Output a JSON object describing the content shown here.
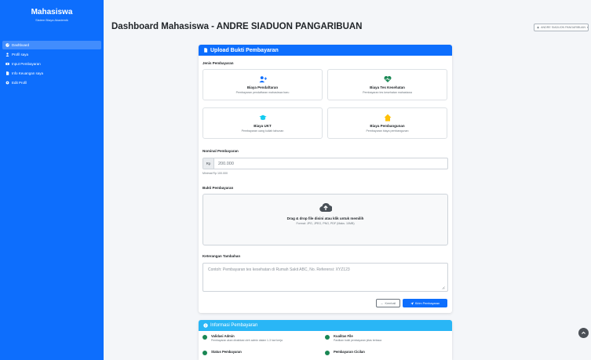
{
  "sidebar": {
    "brand_title": "Mahasiswa",
    "brand_subtitle": "Sistem Biaya Akademik",
    "items": [
      {
        "label": "Dashboard",
        "icon": "dashboard-icon",
        "active": true
      },
      {
        "label": "Profil saya",
        "icon": "user-icon",
        "active": false
      },
      {
        "label": "Input Pembayaran",
        "icon": "money-icon",
        "active": false
      },
      {
        "label": "Info Keuangan saya",
        "icon": "file-icon",
        "active": false
      },
      {
        "label": "Edit Profil",
        "icon": "gear-icon",
        "active": false
      }
    ]
  },
  "header": {
    "title": "Dashboard Mahasiswa - ANDRE SIADUON PANGARIBUAN",
    "user_button": "ANDRE SIADUON PANGARIBUAN"
  },
  "upload": {
    "card_title": "Upload Bukti Pembayaran",
    "jenis_label": "Jenis Pembayaran",
    "options": [
      {
        "title": "Biaya Pendaftaran",
        "desc": "Pembayaran pendaftaran mahasiswa baru",
        "icon": "user-plus-icon",
        "color": "#0d6efd"
      },
      {
        "title": "Biaya Tes Kesehatan",
        "desc": "Pembayaran tes kesehatan mahasiswa",
        "icon": "heartbeat-icon",
        "color": "#198754"
      },
      {
        "title": "Biaya UKT",
        "desc": "Pembayaran uang kuliah tahunan",
        "icon": "graduation-cap-icon",
        "color": "#0dcaf0"
      },
      {
        "title": "Biaya Pembangunan",
        "desc": "Pembayaran biaya pembangunan",
        "icon": "home-icon",
        "color": "#ffc107"
      }
    ],
    "nominal_label": "Nominal Pembayaran",
    "currency": "Rp",
    "nominal_value": "200.000",
    "nominal_hint": "Minimal Rp 100.000",
    "bukti_label": "Bukti Pembayaran",
    "dropzone_title": "Drag & drop file disini atau klik untuk memilih",
    "dropzone_sub": "Format: JPG, JPEG, PNG, PDF (Maks. 10MB)",
    "keterangan_label": "Keterangan Tambahan",
    "keterangan_placeholder": "Contoh: Pembayaran tes kesehatan di Rumah Sakit ABC, No. Referensi: XYZ123",
    "back_button": "Kembali",
    "send_button": "Kirim Pembayaran"
  },
  "info": {
    "card_title": "Informasi Pembayaran",
    "items": [
      {
        "title": "Validasi Admin",
        "desc": "Pembayaran akan divalidasi oleh admin dalam 1-3 hari kerja"
      },
      {
        "title": "Kualitas File",
        "desc": "Pastikan bukti pembayaran jelas terbaca"
      },
      {
        "title": "Status Pembayaran",
        "desc": ""
      },
      {
        "title": "Pembayaran Cicilan",
        "desc": ""
      }
    ]
  },
  "colors": {
    "primary": "#0d6efd",
    "info": "#29b6f6",
    "success": "#198754"
  }
}
